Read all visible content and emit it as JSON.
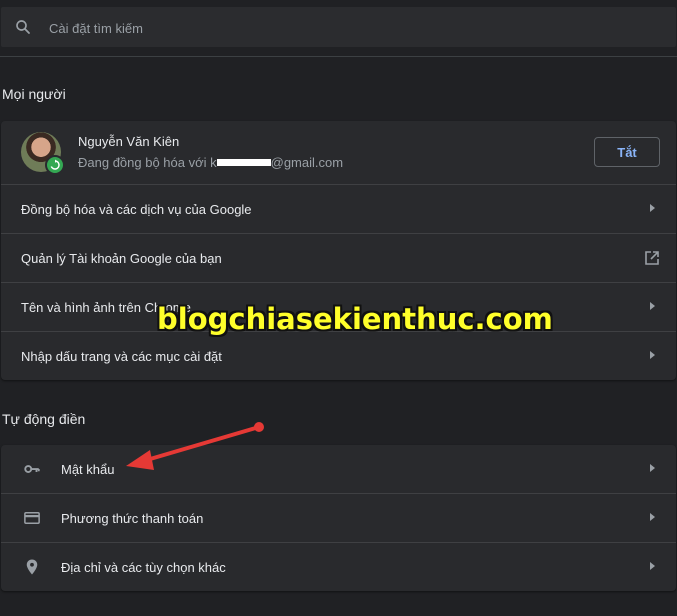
{
  "search": {
    "placeholder": "Cài đặt tìm kiếm",
    "icon": "search-icon"
  },
  "people": {
    "title": "Mọi người",
    "profile": {
      "name": "Nguyễn Văn Kiên",
      "email_prefix": "Đang đồng bộ hóa với k",
      "email_suffix": "@gmail.com",
      "turn_off_label": "Tắt"
    },
    "items": [
      {
        "label": "Đồng bộ hóa và các dịch vụ của Google",
        "icon": "chevron-right-icon"
      },
      {
        "label": "Quản lý Tài khoản Google của bạn",
        "icon": "open-in-new-icon"
      },
      {
        "label": "Tên và hình ảnh trên Chrome",
        "icon": "chevron-right-icon"
      },
      {
        "label": "Nhập dấu trang và các mục cài đặt",
        "icon": "chevron-right-icon"
      }
    ]
  },
  "autofill": {
    "title": "Tự động điền",
    "items": [
      {
        "label": "Mật khẩu",
        "icon": "key-icon"
      },
      {
        "label": "Phương thức thanh toán",
        "icon": "credit-card-icon"
      },
      {
        "label": "Địa chỉ và các tùy chọn khác",
        "icon": "location-pin-icon"
      }
    ]
  },
  "watermark": "blogchiasekienthuc.com",
  "colors": {
    "accent": "#8ab4f8",
    "annotation": "#e53935",
    "watermark": "#ffff2a",
    "background": "#202124",
    "card": "#292a2d"
  }
}
